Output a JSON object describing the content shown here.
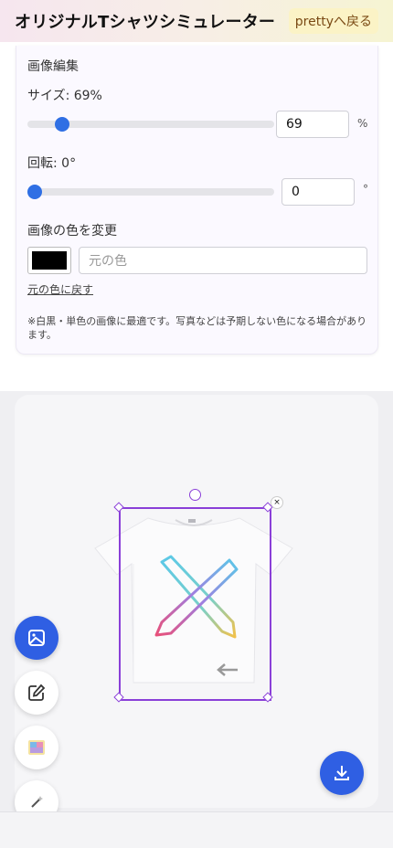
{
  "header": {
    "title": "オリジナルTシャツシミュレーター",
    "back_label": "prettyへ戻る"
  },
  "editor": {
    "section_title": "画像編集",
    "size": {
      "label": "サイズ: 69%",
      "value": "69",
      "unit": "%",
      "fraction": 0.69
    },
    "rotation": {
      "label": "回転: 0°",
      "value": "0",
      "unit": "°",
      "fraction": 0.0
    },
    "color": {
      "label": "画像の色を変更",
      "swatch": "#000000",
      "placeholder": "元の色",
      "reset_label": "元の色に戻す",
      "note": "※白黒・単色の画像に最適です。写真などは予期しない色になる場合があります。"
    }
  },
  "canvas": {
    "selection_color": "#8a3fd8",
    "close_icon": "×"
  },
  "toolbar": {
    "accent": "#2f5fe3",
    "items": [
      "image-icon",
      "edit-icon",
      "sticker-icon",
      "magic-icon"
    ],
    "download_icon": "download-icon"
  }
}
